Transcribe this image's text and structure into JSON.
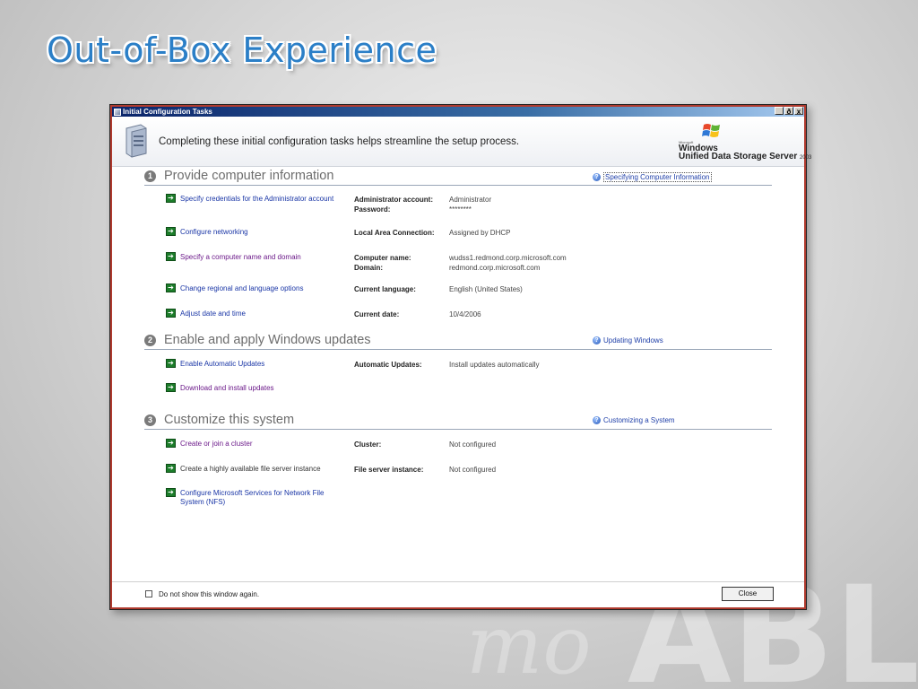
{
  "slide": {
    "title": "Out-of-Box Experience"
  },
  "window": {
    "title": "Initial Configuration Tasks",
    "controls": {
      "minimize": "_",
      "maximize": "ð",
      "close": "x"
    },
    "banner_text": "Completing these initial configuration tasks helps streamline the setup process.",
    "brand": {
      "microsoft": "Microsoft",
      "windows": "Windows",
      "product": "Unified Data Storage Server",
      "year": "2003"
    }
  },
  "sections": [
    {
      "number": "1",
      "title": "Provide computer information",
      "help_link": "Specifying Computer Information",
      "tasks": [
        {
          "link": "Specify credentials for the Administrator account",
          "labels": "Administrator account:\nPassword:",
          "values": "Administrator\n********"
        },
        {
          "link": "Configure networking",
          "labels": "Local Area Connection:",
          "values": "Assigned by DHCP"
        },
        {
          "link": "Specify a computer name and domain",
          "labels": "Computer name:\nDomain:",
          "values": "wudss1.redmond.corp.microsoft.com\nredmond.corp.microsoft.com"
        },
        {
          "link": "Change regional and language options",
          "labels": "Current language:",
          "values": "English (United States)"
        },
        {
          "link": "Adjust date and time",
          "labels": "Current date:",
          "values": "10/4/2006"
        }
      ]
    },
    {
      "number": "2",
      "title": "Enable and apply Windows updates",
      "help_link": "Updating Windows",
      "tasks": [
        {
          "link": "Enable Automatic Updates",
          "labels": "Automatic Updates:",
          "values": "Install updates automatically"
        },
        {
          "link": "Download and install updates",
          "labels": "",
          "values": ""
        }
      ]
    },
    {
      "number": "3",
      "title": "Customize this system",
      "help_link": "Customizing a System",
      "tasks": [
        {
          "link": "Create or join a cluster",
          "labels": "Cluster:",
          "values": "Not configured"
        },
        {
          "link": "Create a highly available file server instance",
          "labels": "File server instance:",
          "values": "Not configured"
        },
        {
          "link": "Configure Microsoft Services for Network File System (NFS)",
          "labels": "",
          "values": ""
        }
      ]
    }
  ],
  "footer": {
    "checkbox_label": "Do not show this window again.",
    "close_label": "Close"
  },
  "colors": {
    "link": "#1a36a6",
    "visited_link": "#6c1a8a",
    "task_arrow": "#1c7d2a",
    "title_blue": "#2b7fc7"
  }
}
